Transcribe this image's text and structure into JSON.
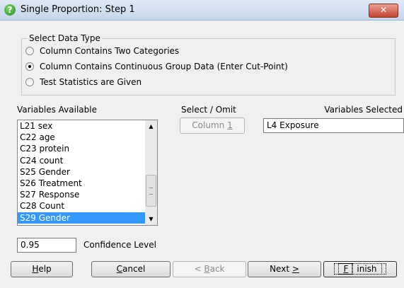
{
  "window": {
    "title": "Single Proportion: Step 1",
    "close_glyph": "✕",
    "icon_glyph": "?"
  },
  "data_type": {
    "legend": "Select Data Type",
    "options": [
      {
        "label": "Column Contains Two Categories",
        "selected": false
      },
      {
        "label": "Column Contains Continuous Group Data (Enter Cut-Point)",
        "selected": true
      },
      {
        "label": "Test Statistics are Given",
        "selected": false
      }
    ]
  },
  "variables_available": {
    "label": "Variables Available",
    "items": [
      "L21 sex",
      "C22 age",
      "C23 protein",
      "C24 count",
      "S25 Gender",
      "S26 Treatment",
      "S27 Response",
      "C28 Count",
      "S29 Gender"
    ],
    "selected_index": 8
  },
  "select_omit": {
    "label": "Select / Omit",
    "button": "Column 1",
    "button_underline_char": "1",
    "button_prefix": "Column "
  },
  "variables_selected": {
    "label": "Variables Selected",
    "value": "L4 Exposure"
  },
  "confidence": {
    "value": "0.95",
    "label": "Confidence Level"
  },
  "buttons": {
    "help": {
      "underline": "H",
      "rest": "elp"
    },
    "cancel": {
      "underline": "C",
      "rest": "ancel"
    },
    "back": {
      "prefix": "< ",
      "underline": "B",
      "rest": "ack"
    },
    "next": {
      "prefix": "Next ",
      "underline": ">",
      "rest": ""
    },
    "finish": {
      "underline": "F",
      "rest": "inish"
    }
  }
}
